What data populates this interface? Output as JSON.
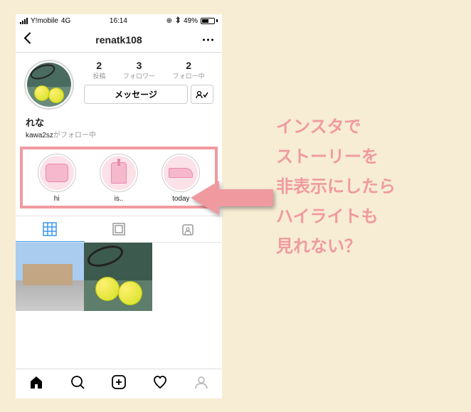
{
  "statusbar": {
    "carrier": "Y!mobile",
    "network": "4G",
    "time": "16:14",
    "battery_pct": "49%"
  },
  "navbar": {
    "title": "renatk108"
  },
  "profile": {
    "stats": {
      "posts": {
        "num": "2",
        "label": "投稿"
      },
      "followers": {
        "num": "3",
        "label": "フォロワー"
      },
      "following": {
        "num": "2",
        "label": "フォロー中"
      }
    },
    "message_button": "メッセージ",
    "display_name": "れな",
    "followed_by_user": "kawa2sz",
    "followed_by_suffix": "がフォロー中"
  },
  "highlights": [
    {
      "label": "hi"
    },
    {
      "label": "is.."
    },
    {
      "label": "today"
    }
  ],
  "caption": {
    "l1": "インスタで",
    "l2": "ストーリーを",
    "l3": "非表示にしたら",
    "l4": "ハイライトも",
    "l5": "見れない？"
  }
}
